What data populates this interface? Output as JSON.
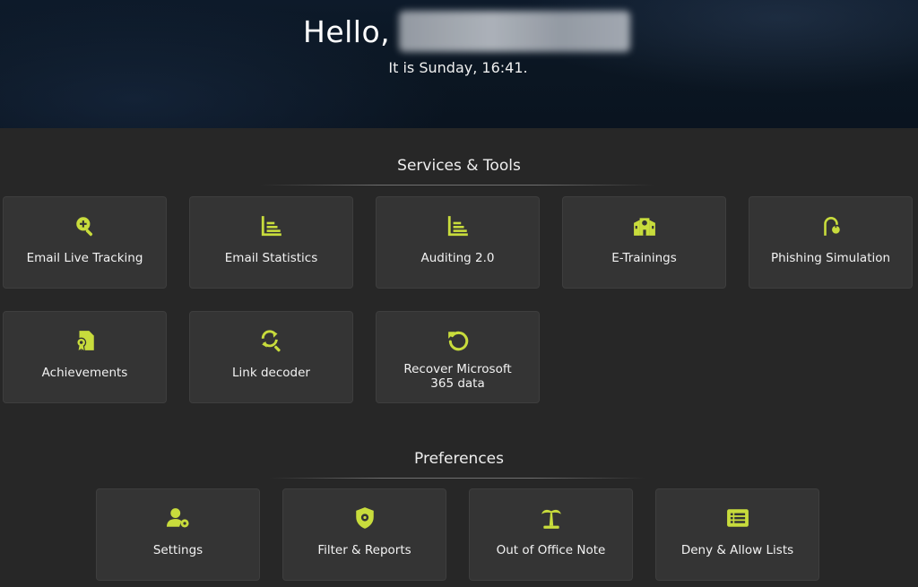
{
  "header": {
    "greeting": "Hello,",
    "time_text": "It is Sunday, 16:41."
  },
  "services": {
    "title": "Services & Tools",
    "tiles": [
      {
        "label": "Email Live Tracking",
        "icon": "zoom-plus-icon"
      },
      {
        "label": "Email Statistics",
        "icon": "list-chart-icon"
      },
      {
        "label": "Auditing 2.0",
        "icon": "list-chart-icon"
      },
      {
        "label": "E-Trainings",
        "icon": "school-icon"
      },
      {
        "label": "Phishing Simulation",
        "icon": "hook-icon"
      },
      {
        "label": "Achievements",
        "icon": "certificate-icon"
      },
      {
        "label": "Link decoder",
        "icon": "search-refresh-icon"
      },
      {
        "label": "Recover Microsoft 365 data",
        "icon": "restore-icon"
      }
    ]
  },
  "preferences": {
    "title": "Preferences",
    "tiles": [
      {
        "label": "Settings",
        "icon": "user-gear-icon"
      },
      {
        "label": "Filter & Reports",
        "icon": "shield-gear-icon"
      },
      {
        "label": "Out of Office Note",
        "icon": "palm-tree-icon"
      },
      {
        "label": "Deny & Allow Lists",
        "icon": "list-box-icon"
      }
    ]
  },
  "colors": {
    "accent": "#c8dc3c",
    "background": "#272727",
    "tile": "#343434"
  }
}
